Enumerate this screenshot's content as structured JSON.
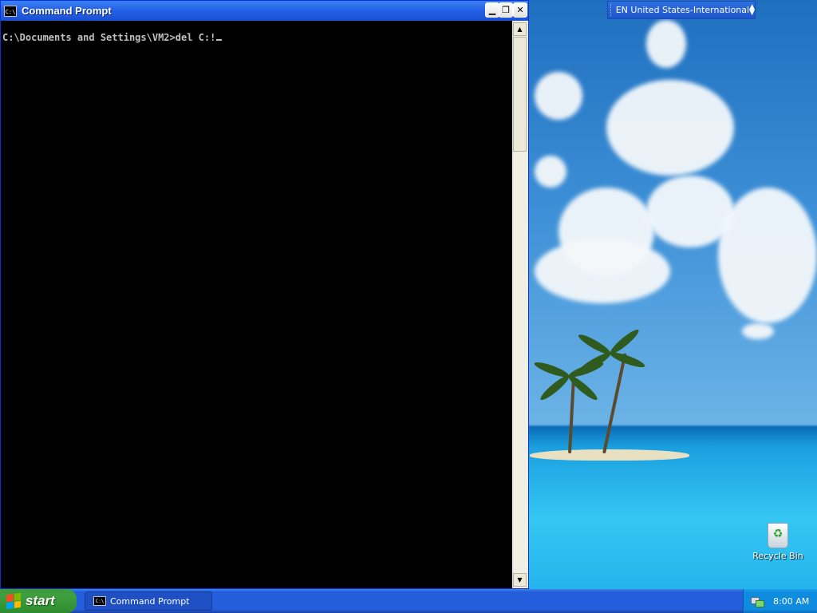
{
  "window": {
    "title": "Command Prompt",
    "icon": "cmd-icon",
    "icon_text": "C:\\",
    "controls": [
      "minimize",
      "restore",
      "close"
    ]
  },
  "console": {
    "line": "C:\\Documents and Settings\\VM2>del C:!"
  },
  "language_bar": {
    "text": "EN United States-International"
  },
  "desktop": {
    "icons": [
      {
        "label": "Recycle Bin",
        "icon": "recycle-bin-icon"
      }
    ]
  },
  "taskbar": {
    "start_label": "start",
    "tasks": [
      {
        "label": "Command Prompt",
        "icon": "cmd-icon",
        "icon_text": "C:\\"
      }
    ],
    "clock": "8:00 AM"
  }
}
